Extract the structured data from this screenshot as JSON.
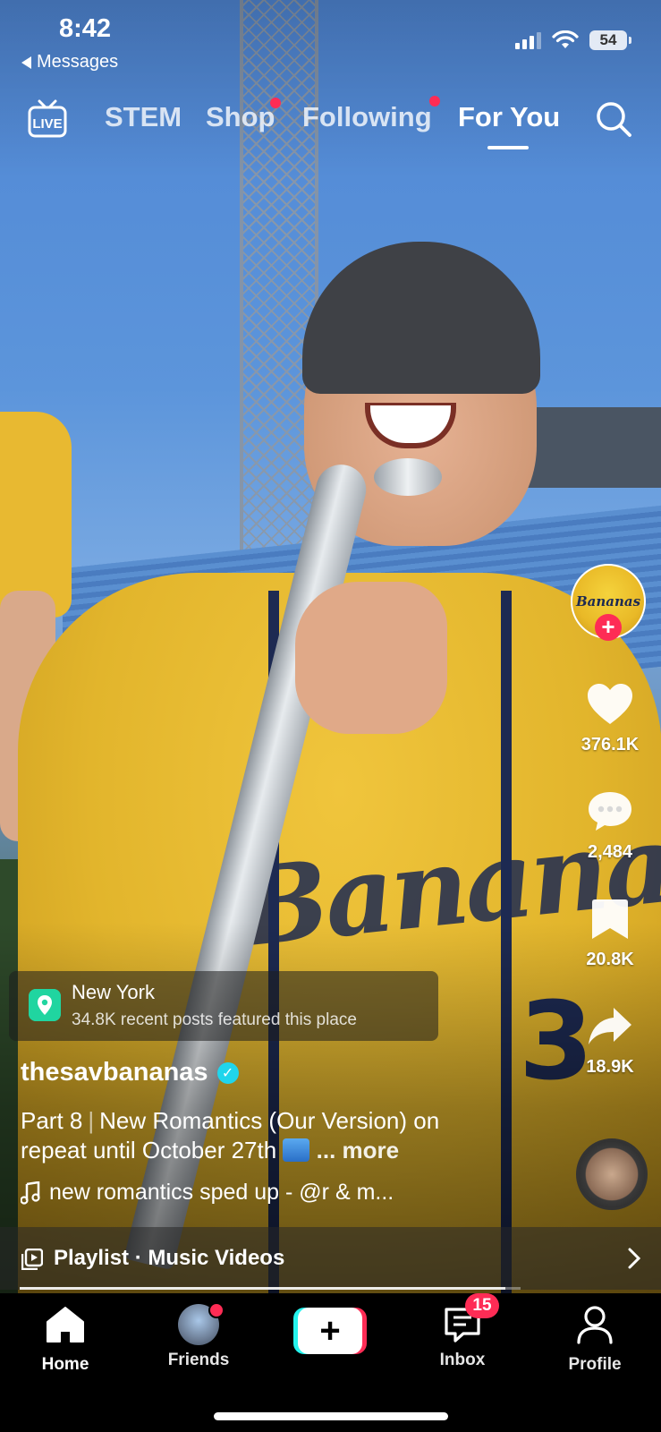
{
  "status_bar": {
    "time": "8:42",
    "back_label": "Messages",
    "battery": "54"
  },
  "top_nav": {
    "live_icon": "live-tv-icon",
    "tabs": [
      {
        "label": "STEM",
        "active": false,
        "dot": false
      },
      {
        "label": "Shop",
        "active": false,
        "dot": true
      },
      {
        "label": "Following",
        "active": false,
        "dot": true
      },
      {
        "label": "For You",
        "active": true,
        "dot": false
      }
    ],
    "search_icon": "search-icon"
  },
  "right_rail": {
    "creator_avatar_text": "Bananas",
    "likes": "376.1K",
    "comments": "2,484",
    "saves": "20.8K",
    "shares": "18.9K"
  },
  "location": {
    "name": "New York",
    "subtitle": "34.8K recent posts featured this place"
  },
  "post": {
    "username": "thesavbananas",
    "verified": true,
    "caption_part": "Part 8",
    "caption_text": "New Romantics (Our Version) on repeat until October 27th",
    "caption_more": "... more",
    "music": "new romantics sped up - @r & m..."
  },
  "playlist": {
    "label": "Playlist · Music Videos",
    "progress_fraction": 0.97
  },
  "tab_bar": {
    "home": "Home",
    "friends": "Friends",
    "inbox": "Inbox",
    "inbox_badge": "15",
    "profile": "Profile"
  },
  "colors": {
    "accent_red": "#fe2c55",
    "accent_cyan": "#25f4ee",
    "verified_blue": "#20d5ec",
    "location_green": "#20d5a0"
  }
}
